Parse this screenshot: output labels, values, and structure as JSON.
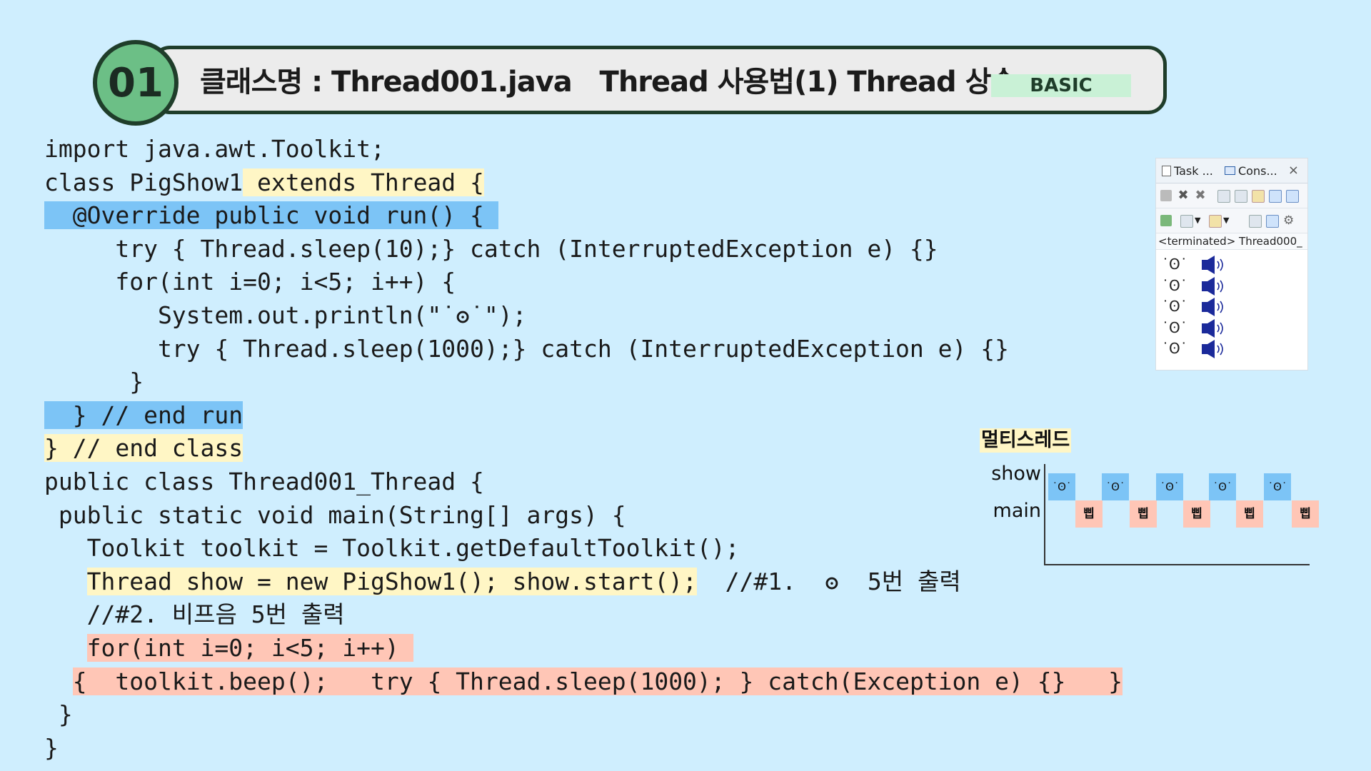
{
  "header": {
    "number": "01",
    "title": "클래스명 : Thread001.java   Thread 사용법(1) Thread 상속",
    "level": "BASIC"
  },
  "code": {
    "l1": "import java.awt.Toolkit;",
    "l2a": "class PigShow1",
    "l2b": " extends Thread {",
    "l3": "  @Override public void run() { ",
    "l4": "     try { Thread.sleep(10);} catch (InterruptedException e) {}",
    "l5": "     for(int i=0; i<5; i++) {",
    "l6": "        System.out.println(\"˙ʘ˙\");",
    "l7": "        try { Thread.sleep(1000);} catch (InterruptedException e) {}",
    "l8": "      }",
    "l9": "  } // end run",
    "l10": "} // end class",
    "l11": "public class Thread001_Thread {",
    "l12": " public static void main(String[] args) {",
    "l13": "   Toolkit toolkit = Toolkit.getDefaultToolkit();",
    "l14_indent": "   ",
    "l14a": "Thread show = new PigShow1(); show.start();",
    "l14b": "  //#1.",
    "l14c": "ʘ",
    "l14d": "5번 출력",
    "l15": "   //#2. 비프음 5번 출력",
    "l16_indent": "   ",
    "l16": "for(int i=0; i<5; i++) ",
    "l17_indent": "  ",
    "l17": "{  toolkit.beep();   try { Thread.sleep(1000); } catch(Exception e) {}   }",
    "l18": " }",
    "l19": "}"
  },
  "console": {
    "tab_task": "Task ...",
    "tab_console": "Cons...",
    "close": "×",
    "status": "<terminated> Thread000_",
    "output": [
      "˙ʘ˙",
      "˙ʘ˙",
      "˙ʘ˙",
      "˙ʘ˙",
      "˙ʘ˙"
    ]
  },
  "timeline": {
    "title": "멀티스레드",
    "show_label": "show",
    "main_label": "main",
    "show_mark": "˙ʘ˙",
    "main_mark": "삡",
    "show_slots": 5,
    "main_slots": 5
  },
  "colors": {
    "background": "#cfeefe",
    "highlight_yellow": "#fff6c5",
    "highlight_blue": "#7cc4f6",
    "highlight_pink": "#ffc6b6",
    "badge_green": "#6cbf86"
  },
  "icons": [
    "speaker-icon",
    "terminate-icon",
    "remove-icon",
    "pin-console-icon"
  ]
}
